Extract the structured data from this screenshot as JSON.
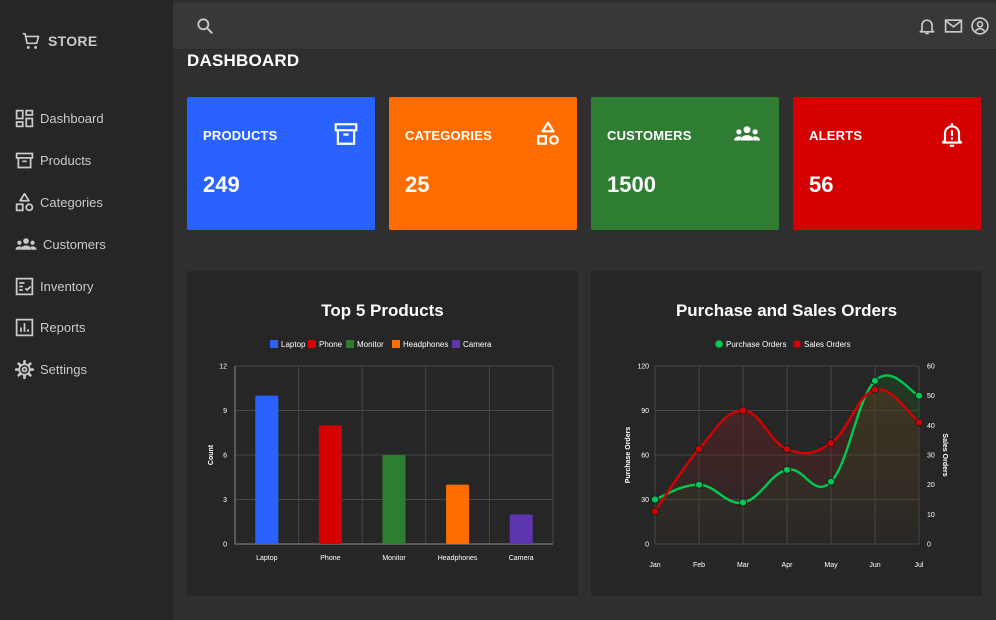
{
  "brand": {
    "name": "STORE",
    "icon": "cart-icon"
  },
  "sidebar": {
    "items": [
      {
        "label": "Dashboard",
        "icon": "dashboard-icon"
      },
      {
        "label": "Products",
        "icon": "archive-icon"
      },
      {
        "label": "Categories",
        "icon": "shapes-icon"
      },
      {
        "label": "Customers",
        "icon": "people-icon"
      },
      {
        "label": "Inventory",
        "icon": "checklist-icon"
      },
      {
        "label": "Reports",
        "icon": "bar-report-icon"
      },
      {
        "label": "Settings",
        "icon": "gear-icon"
      }
    ]
  },
  "header": {
    "icons": [
      "search-icon",
      "bell-icon",
      "mail-icon",
      "account-icon"
    ]
  },
  "page": {
    "title": "DASHBOARD"
  },
  "cards": [
    {
      "label": "PRODUCTS",
      "value": "249",
      "color": "#2962ff",
      "icon": "archive-icon"
    },
    {
      "label": "CATEGORIES",
      "value": "25",
      "color": "#ff6d00",
      "icon": "shapes-icon"
    },
    {
      "label": "CUSTOMERS",
      "value": "1500",
      "color": "#2e7d32",
      "icon": "people-icon"
    },
    {
      "label": "ALERTS",
      "value": "56",
      "color": "#d50000",
      "icon": "bell-alert-icon"
    }
  ],
  "chart_data": [
    {
      "type": "bar",
      "title": "Top 5 Products",
      "categories": [
        "Laptop",
        "Phone",
        "Monitor",
        "Headphones",
        "Camera"
      ],
      "values": [
        10,
        8,
        6,
        4,
        2
      ],
      "colors": [
        "#2962ff",
        "#d50000",
        "#2e7d32",
        "#ff6d00",
        "#5e35b1"
      ],
      "legend": [
        "Laptop",
        "Phone",
        "Monitor",
        "Headphones",
        "Camera"
      ],
      "ylabel": "Count",
      "ylim": [
        0,
        12
      ],
      "yticks": [
        0,
        3,
        6,
        9,
        12
      ],
      "grid": true,
      "legend_position": "top"
    },
    {
      "type": "line",
      "title": "Purchase and Sales Orders",
      "x": [
        "Jan",
        "Feb",
        "Mar",
        "Apr",
        "May",
        "Jun",
        "Jul"
      ],
      "series": [
        {
          "name": "Purchase Orders",
          "values": [
            30,
            40,
            28,
            50,
            42,
            110,
            100
          ],
          "color": "#00c853",
          "axis": "left"
        },
        {
          "name": "Sales Orders",
          "values": [
            11,
            32,
            45,
            32,
            34,
            52,
            41
          ],
          "color": "#d50000",
          "axis": "right"
        }
      ],
      "ylabel_left": "Purchase Orders",
      "ylabel_right": "Sales Orders",
      "ylim_left": [
        0,
        120
      ],
      "yticks_left": [
        0,
        30,
        60,
        90,
        120
      ],
      "ylim_right": [
        0,
        60
      ],
      "yticks_right": [
        0,
        10,
        20,
        30,
        40,
        50,
        60
      ],
      "grid": true,
      "legend_position": "top"
    }
  ]
}
